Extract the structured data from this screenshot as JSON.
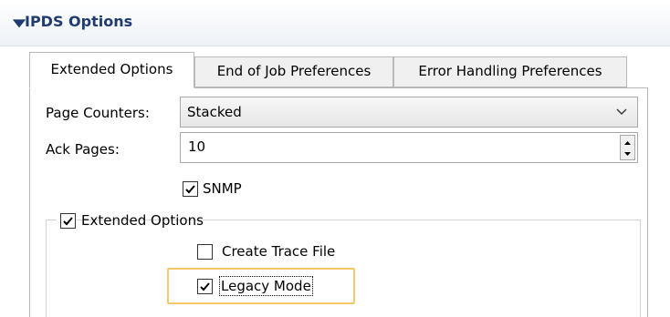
{
  "section": {
    "title": "IPDS Options",
    "toggle_icon": "triangle-down-icon"
  },
  "tabs": [
    {
      "label": "Extended Options",
      "active": true
    },
    {
      "label": "End of Job Preferences",
      "active": false
    },
    {
      "label": "Error Handling Preferences",
      "active": false
    }
  ],
  "form": {
    "page_counters": {
      "label": "Page Counters:",
      "value": "Stacked"
    },
    "ack_pages": {
      "label": "Ack Pages:",
      "value": "10"
    },
    "snmp": {
      "label": "SNMP",
      "checked": true
    }
  },
  "extended_group": {
    "label": "Extended Options",
    "checked": true,
    "create_trace_file": {
      "label": "Create Trace File",
      "checked": false
    },
    "legacy_mode": {
      "label": "Legacy Mode",
      "checked": true
    }
  },
  "colors": {
    "title": "#1f3b6f",
    "focus": "#f6c86a",
    "border": "#b9b9b9"
  }
}
